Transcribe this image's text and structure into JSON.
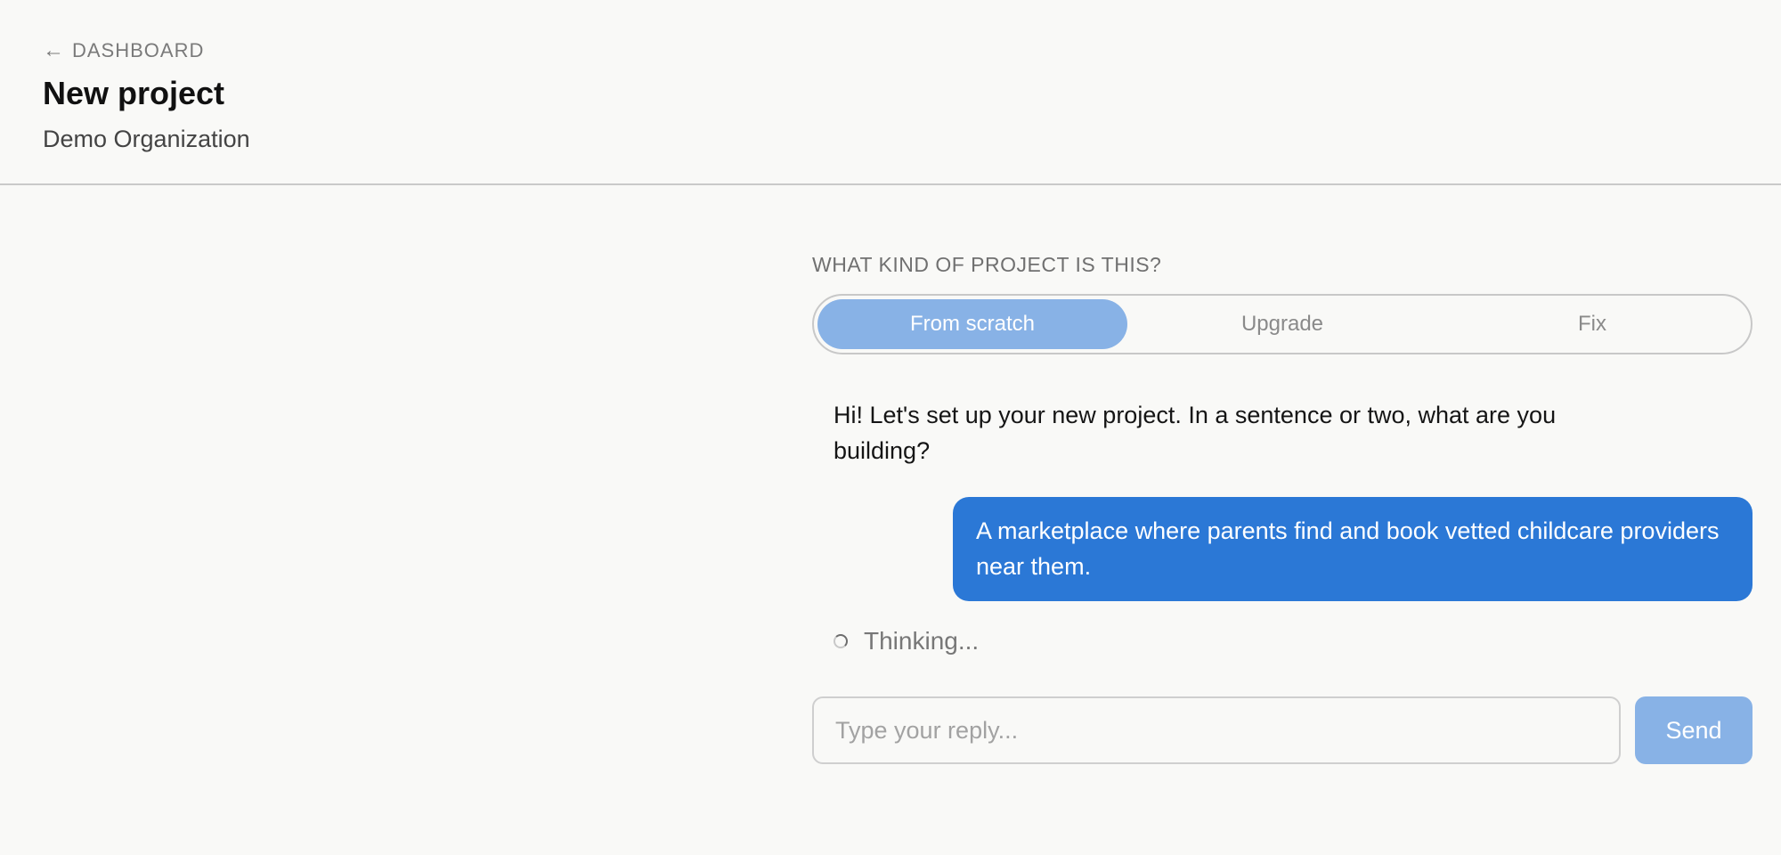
{
  "header": {
    "back_arrow": "←",
    "back_label": "DASHBOARD",
    "title": "New project",
    "organization": "Demo Organization"
  },
  "project_type": {
    "question": "WHAT KIND OF PROJECT IS THIS?",
    "options": [
      {
        "label": "From scratch",
        "selected": true
      },
      {
        "label": "Upgrade",
        "selected": false
      },
      {
        "label": "Fix",
        "selected": false
      }
    ]
  },
  "conversation": {
    "assistant_message": "Hi! Let's set up your new project. In a sentence or two, what are you building?",
    "user_message": "A marketplace where parents find and book vetted childcare providers near them.",
    "status": "Thinking..."
  },
  "reply": {
    "placeholder": "Type your reply...",
    "value": "",
    "send_label": "Send"
  },
  "colors": {
    "background": "#f9f9f7",
    "accent": "#2b78d6",
    "accent_muted": "#88b2e6",
    "divider": "#c9c9c9"
  }
}
